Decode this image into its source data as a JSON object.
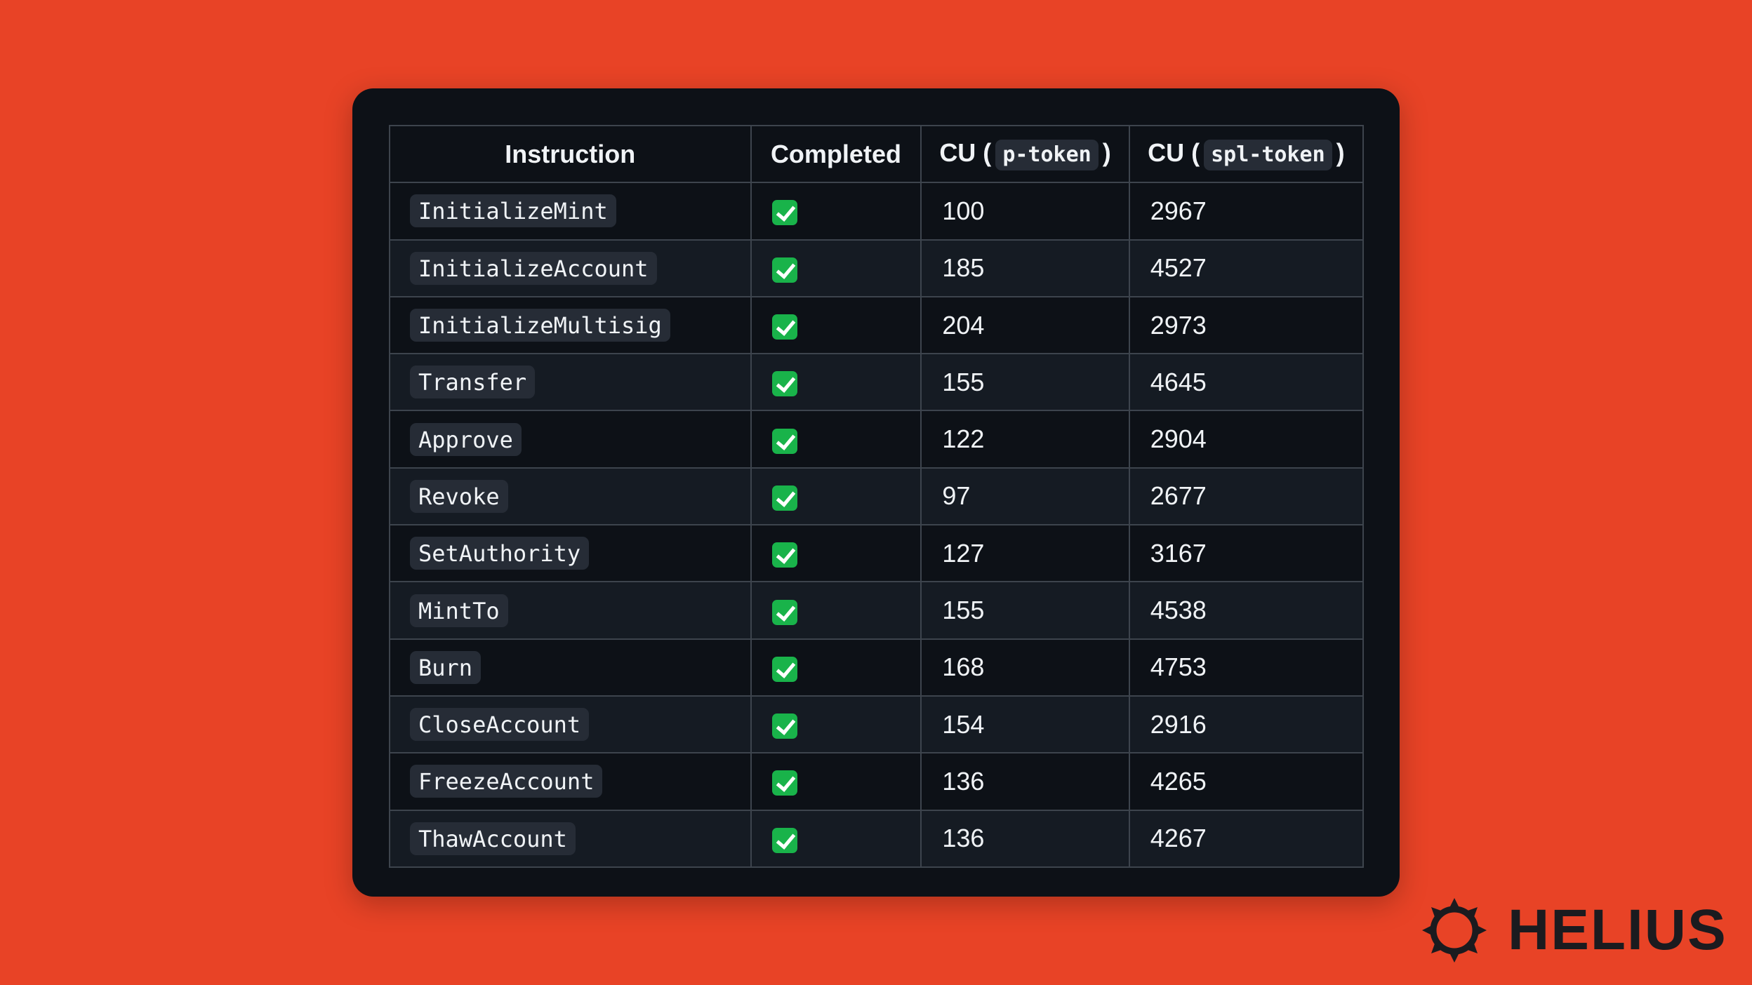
{
  "table": {
    "headers": {
      "instruction": "Instruction",
      "completed": "Completed",
      "cu_prefix_1": "CU (",
      "cu_code_1": "p-token",
      "cu_suffix_1": ")",
      "cu_prefix_2": "CU (",
      "cu_code_2": "spl-token",
      "cu_suffix_2": ")"
    },
    "rows": [
      {
        "instruction": "InitializeMint",
        "completed": "check",
        "p_token": "100",
        "spl_token": "2967"
      },
      {
        "instruction": "InitializeAccount",
        "completed": "check",
        "p_token": "185",
        "spl_token": "4527"
      },
      {
        "instruction": "InitializeMultisig",
        "completed": "check",
        "p_token": "204",
        "spl_token": "2973"
      },
      {
        "instruction": "Transfer",
        "completed": "check",
        "p_token": "155",
        "spl_token": "4645"
      },
      {
        "instruction": "Approve",
        "completed": "check",
        "p_token": "122",
        "spl_token": "2904"
      },
      {
        "instruction": "Revoke",
        "completed": "check",
        "p_token": "97",
        "spl_token": "2677"
      },
      {
        "instruction": "SetAuthority",
        "completed": "check",
        "p_token": "127",
        "spl_token": "3167"
      },
      {
        "instruction": "MintTo",
        "completed": "check",
        "p_token": "155",
        "spl_token": "4538"
      },
      {
        "instruction": "Burn",
        "completed": "check",
        "p_token": "168",
        "spl_token": "4753"
      },
      {
        "instruction": "CloseAccount",
        "completed": "check",
        "p_token": "154",
        "spl_token": "2916"
      },
      {
        "instruction": "FreezeAccount",
        "completed": "check",
        "p_token": "136",
        "spl_token": "4265"
      },
      {
        "instruction": "ThawAccount",
        "completed": "check",
        "p_token": "136",
        "spl_token": "4267"
      }
    ]
  },
  "brand": {
    "name": "HELIUS",
    "icon": "helius-sun-icon"
  },
  "colors": {
    "background": "#e84326",
    "card": "#0d1117",
    "row_alt": "#151b23",
    "check": "#19b34a"
  }
}
